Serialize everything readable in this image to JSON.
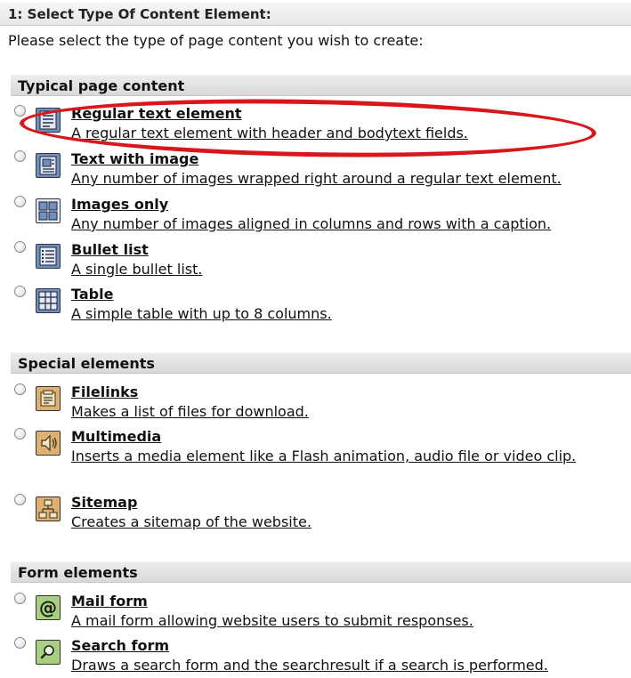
{
  "step_title": "1: Select Type Of Content Element:",
  "intro": "Please select the type of page content you wish to create:",
  "sections": {
    "typical": {
      "header": "Typical page content",
      "items": [
        {
          "title": "Regular text element",
          "desc": "A regular text element with header and bodytext fields.",
          "icon": "text-element-icon"
        },
        {
          "title": "Text with image",
          "desc": "Any number of images wrapped right around a regular text element.",
          "icon": "text-with-image-icon"
        },
        {
          "title": "Images only",
          "desc": "Any number of images aligned in columns and rows with a caption.",
          "icon": "images-icon"
        },
        {
          "title": "Bullet list",
          "desc": "A single bullet list.",
          "icon": "bullet-list-icon"
        },
        {
          "title": "Table",
          "desc": "A simple table with up to 8 columns.",
          "icon": "table-icon"
        }
      ]
    },
    "special": {
      "header": "Special elements",
      "items": [
        {
          "title": "Filelinks",
          "desc": "Makes a list of files for download.",
          "icon": "filelinks-icon"
        },
        {
          "title": "Multimedia",
          "desc": "Inserts a media element like a Flash animation, audio file or video clip.",
          "icon": "multimedia-icon"
        },
        {
          "title": "Sitemap",
          "desc": "Creates a sitemap of the website.",
          "icon": "sitemap-icon"
        }
      ]
    },
    "form": {
      "header": "Form elements",
      "items": [
        {
          "title": "Mail form",
          "desc": "A mail form allowing website users to submit responses.",
          "icon": "mail-form-icon"
        },
        {
          "title": "Search form",
          "desc": "Draws a search form and the searchresult if a search is performed.",
          "icon": "search-form-icon"
        }
      ]
    }
  },
  "highlight_color": "#d8171c"
}
